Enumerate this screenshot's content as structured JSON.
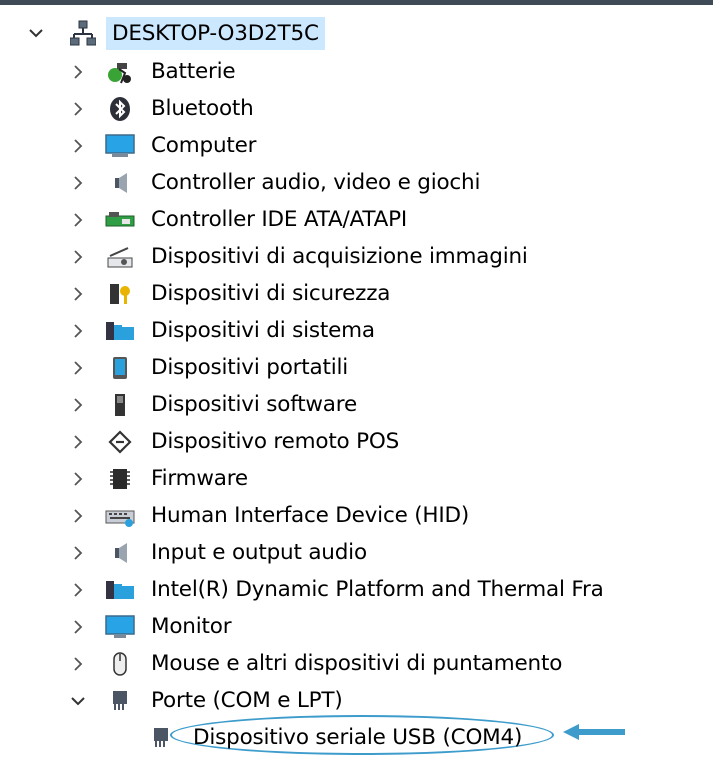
{
  "root": {
    "label": "DESKTOP-O3D2T5C",
    "icon": "network-computer-icon",
    "expanded": true
  },
  "categories": [
    {
      "key": "batterie",
      "label": "Batterie",
      "icon": "battery-icon"
    },
    {
      "key": "bluetooth",
      "label": "Bluetooth",
      "icon": "bluetooth-icon"
    },
    {
      "key": "computer",
      "label": "Computer",
      "icon": "computer-icon"
    },
    {
      "key": "controller-audio",
      "label": "Controller audio, video e giochi",
      "icon": "speaker-icon"
    },
    {
      "key": "controller-ide",
      "label": "Controller IDE ATA/ATAPI",
      "icon": "ide-controller-icon"
    },
    {
      "key": "acquisizione",
      "label": "Dispositivi di acquisizione immagini",
      "icon": "scanner-icon"
    },
    {
      "key": "sicurezza",
      "label": "Dispositivi di sicurezza",
      "icon": "security-key-icon"
    },
    {
      "key": "sistema",
      "label": "Dispositivi di sistema",
      "icon": "system-folder-icon"
    },
    {
      "key": "portatili",
      "label": "Dispositivi portatili",
      "icon": "portable-device-icon"
    },
    {
      "key": "software",
      "label": "Dispositivi software",
      "icon": "software-device-icon"
    },
    {
      "key": "pos",
      "label": "Dispositivo remoto POS",
      "icon": "pos-icon"
    },
    {
      "key": "firmware",
      "label": "Firmware",
      "icon": "chip-icon"
    },
    {
      "key": "hid",
      "label": "Human Interface Device (HID)",
      "icon": "keyboard-icon"
    },
    {
      "key": "input-output-audio",
      "label": "Input e output audio",
      "icon": "speaker-icon"
    },
    {
      "key": "intel",
      "label": "Intel(R) Dynamic Platform and Thermal Fra",
      "icon": "system-folder-icon"
    },
    {
      "key": "monitor",
      "label": "Monitor",
      "icon": "monitor-icon"
    },
    {
      "key": "mouse",
      "label": "Mouse e altri dispositivi di puntamento",
      "icon": "mouse-icon"
    },
    {
      "key": "porte",
      "label": "Porte (COM e LPT)",
      "icon": "port-icon",
      "expanded": true
    }
  ],
  "selected_device": {
    "label": "Dispositivo seriale USB (COM4)",
    "icon": "usb-serial-port-icon"
  },
  "colors": {
    "selection": "#cce8ff",
    "annotation": "#3d9ccc"
  }
}
